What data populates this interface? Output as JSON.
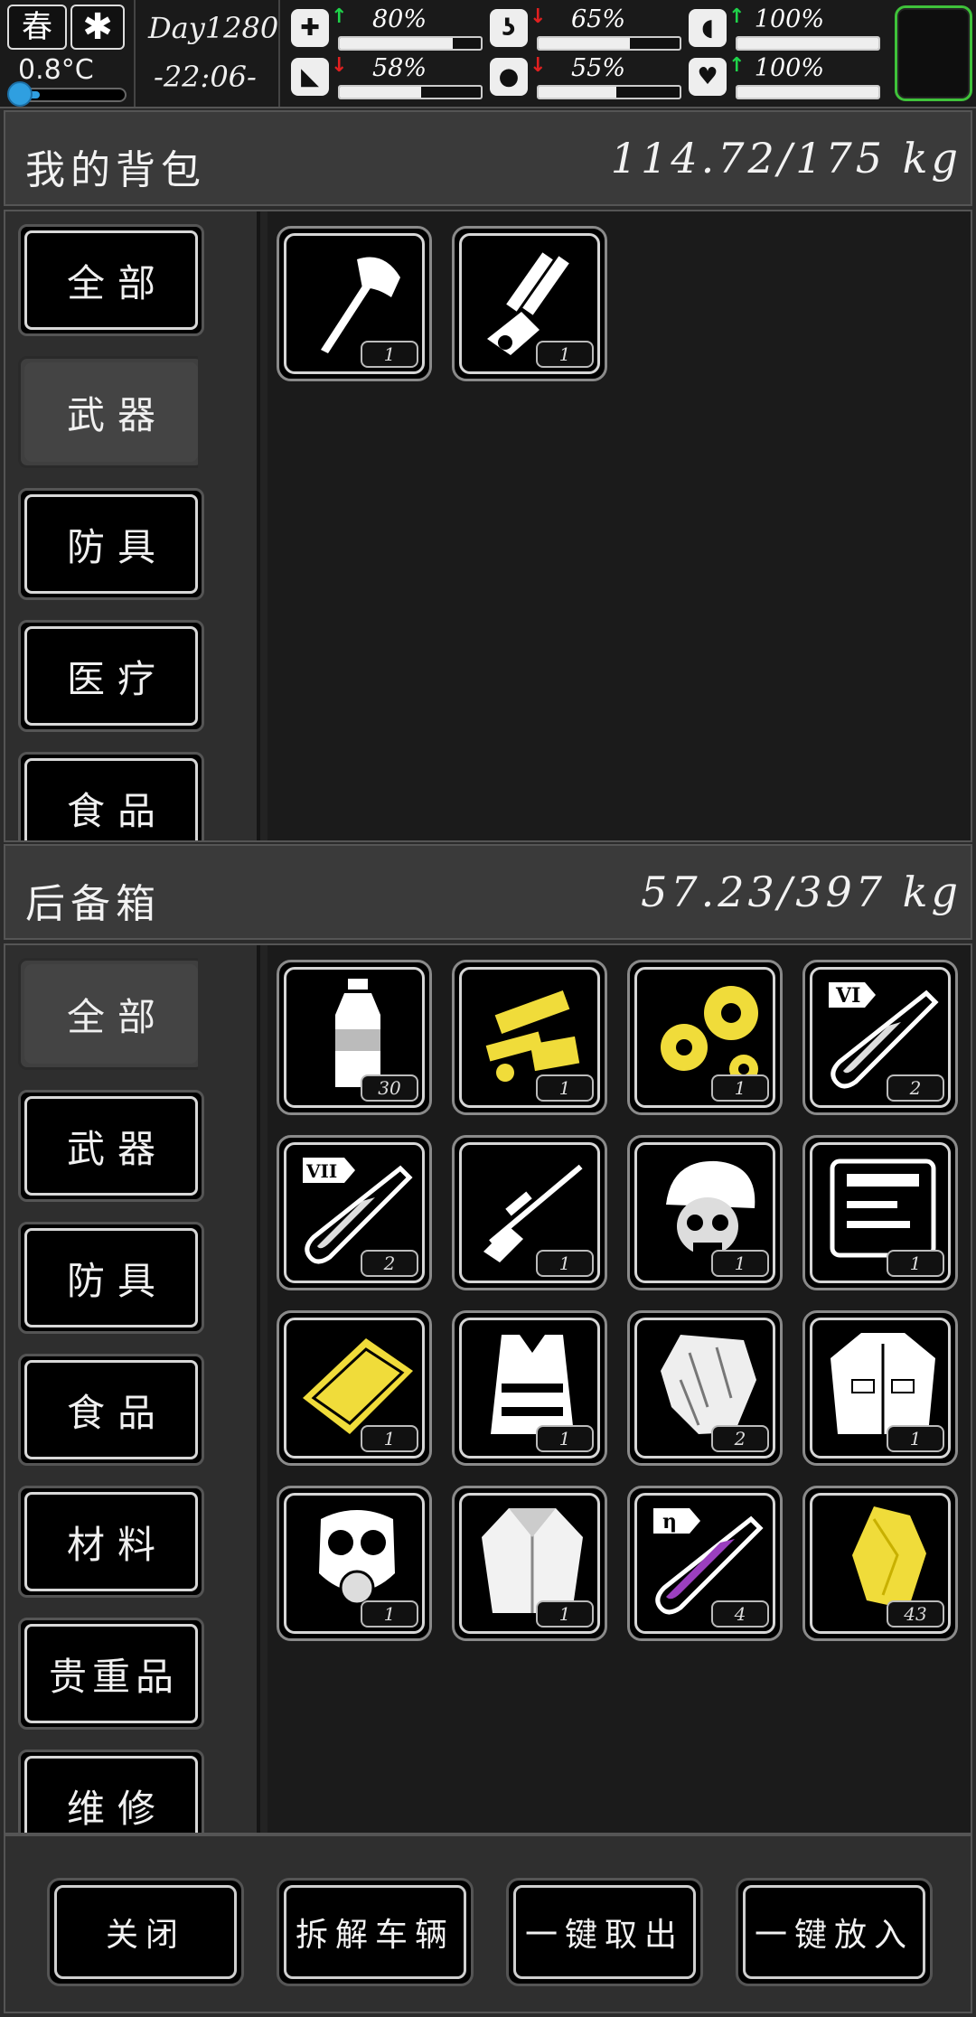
{
  "status": {
    "season": "春",
    "weather_icon": "snowflake-icon",
    "temperature": "0.8°C",
    "temperature_level": 0.2,
    "day": "Day1280",
    "time": "-22:06-",
    "stats": [
      {
        "name": "health",
        "icon": "medkit-icon",
        "trend": "up",
        "percent": "80%",
        "level": 80
      },
      {
        "name": "hunger",
        "icon": "stomach-icon",
        "trend": "down",
        "percent": "65%",
        "level": 65
      },
      {
        "name": "medicine",
        "icon": "pill-icon",
        "trend": "up",
        "percent": "100%",
        "level": 100
      },
      {
        "name": "stamina",
        "icon": "boot-icon",
        "trend": "down",
        "percent": "58%",
        "level": 58
      },
      {
        "name": "thirst",
        "icon": "water-drop-icon",
        "trend": "down",
        "percent": "55%",
        "level": 55
      },
      {
        "name": "mood",
        "icon": "heart-icon",
        "trend": "up",
        "percent": "100%",
        "level": 100
      }
    ],
    "portrait_border_color": "#3fc23a"
  },
  "backpack": {
    "title": "我的背包",
    "weight": "114.72/175 kg",
    "categories": [
      "全部",
      "武器",
      "防具",
      "医疗",
      "食品"
    ],
    "active_category": "武器",
    "items": [
      {
        "icon": "axe-icon",
        "qty": "1"
      },
      {
        "icon": "minigun-icon",
        "qty": "1"
      }
    ]
  },
  "storage": {
    "title": "后备箱",
    "weight": "57.23/397 kg",
    "categories": [
      "全部",
      "武器",
      "防具",
      "食品",
      "材料",
      "贵重品",
      "维修"
    ],
    "active_category": "全部",
    "items": [
      {
        "icon": "water-bottle-icon",
        "qty": "30"
      },
      {
        "icon": "gun-parts-icon",
        "qty": "1"
      },
      {
        "icon": "gears-icon",
        "qty": "1"
      },
      {
        "icon": "test-tube-vi-icon",
        "qty": "2",
        "label": "VI"
      },
      {
        "icon": "test-tube-vii-icon",
        "qty": "2",
        "label": "VII"
      },
      {
        "icon": "sniper-rifle-icon",
        "qty": "1"
      },
      {
        "icon": "helmet-skull-icon",
        "qty": "1"
      },
      {
        "icon": "toolbox-icon",
        "qty": "1"
      },
      {
        "icon": "metal-plate-icon",
        "qty": "1"
      },
      {
        "icon": "tactical-vest-icon",
        "qty": "1"
      },
      {
        "icon": "fur-scraps-icon",
        "qty": "2"
      },
      {
        "icon": "jacket-icon",
        "qty": "1"
      },
      {
        "icon": "gas-mask-icon",
        "qty": "1"
      },
      {
        "icon": "fur-coat-icon",
        "qty": "1"
      },
      {
        "icon": "test-tube-eta-icon",
        "qty": "4",
        "label": "η"
      },
      {
        "icon": "gold-nugget-icon",
        "qty": "43"
      }
    ]
  },
  "footer": {
    "buttons": [
      "关闭",
      "拆解车辆",
      "一键取出",
      "一键放入"
    ]
  },
  "colors": {
    "accent_yellow": "#f0dc3a",
    "arrow_up": "#1fd34a",
    "arrow_down": "#e02020",
    "temp_blue": "#2f9fe0",
    "purple_liquid": "#9b3fbf"
  }
}
